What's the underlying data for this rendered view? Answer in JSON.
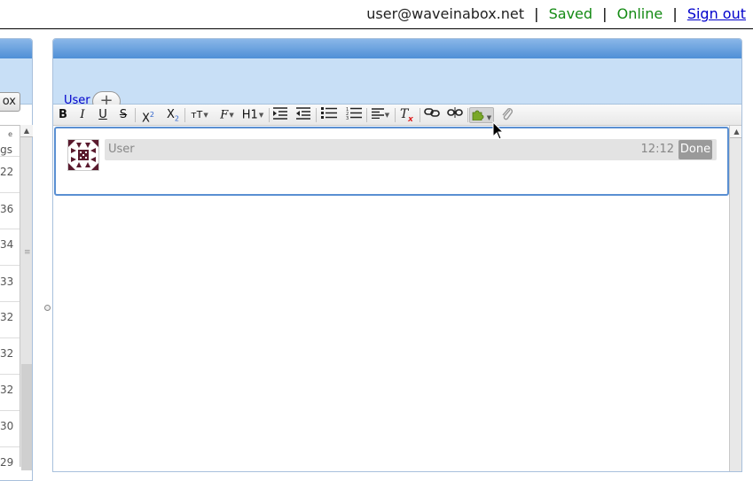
{
  "status_bar": {
    "user": "user@waveinabox.net",
    "separator": "|",
    "saved": "Saved",
    "online": "Online",
    "sign_out": "Sign out"
  },
  "left_panel": {
    "button_label": "ox",
    "column_label": "gs",
    "rows": [
      "22",
      "36",
      "34",
      "33",
      "32",
      "32",
      "32",
      "30",
      "29"
    ]
  },
  "wave_panel": {
    "participant": "User",
    "add_participant": "+"
  },
  "editor_toolbar": {
    "bold": "B",
    "italic": "I",
    "underline": "U",
    "strikethrough": "S",
    "superscript": "X",
    "superscript_mark": "2",
    "subscript": "X",
    "subscript_mark": "2",
    "font_size": "тT",
    "font_family": "F",
    "heading": "H1"
  },
  "blip": {
    "author": "User",
    "time": "12:12",
    "done": "Done"
  },
  "icons": {
    "puzzle_color": "#7aa828",
    "clear_format_color": "#d22"
  }
}
